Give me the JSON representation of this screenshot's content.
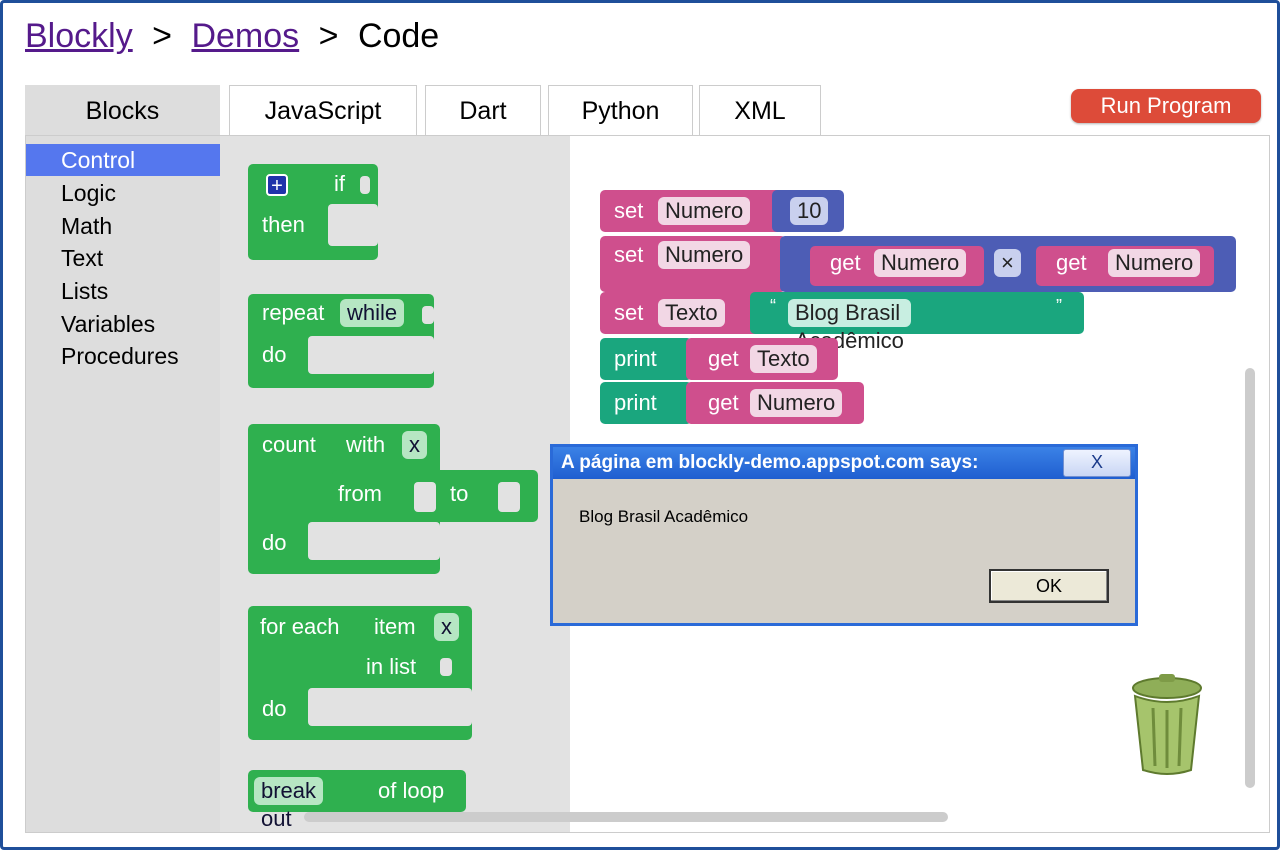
{
  "breadcrumb": {
    "link1": "Blockly",
    "sep1": ">",
    "link2": "Demos",
    "sep2": ">",
    "current": "Code"
  },
  "tabs": [
    {
      "label": "Blocks",
      "active": true
    },
    {
      "label": "JavaScript"
    },
    {
      "label": "Dart"
    },
    {
      "label": "Python"
    },
    {
      "label": "XML"
    }
  ],
  "run_button": "Run Program",
  "toolbox": [
    "Control",
    "Logic",
    "Math",
    "Text",
    "Lists",
    "Variables",
    "Procedures"
  ],
  "flyout": {
    "if_block": {
      "if": "if",
      "then": "then"
    },
    "repeat_block": {
      "repeat": "repeat",
      "mode": "while",
      "do": "do"
    },
    "count_block": {
      "count": "count",
      "with": "with",
      "var": "x",
      "from": "from",
      "to": "to",
      "do": "do"
    },
    "foreach_block": {
      "for_each": "for each",
      "item": "item",
      "var": "x",
      "in_list": "in list",
      "do": "do"
    },
    "break_block": {
      "break_out": "break out",
      "of_loop": "of loop"
    }
  },
  "program": {
    "set1": {
      "set": "set",
      "var": "Numero",
      "value": "10"
    },
    "set2": {
      "set": "set",
      "var": "Numero",
      "get1": "get",
      "var1": "Numero",
      "op": "×",
      "get2": "get",
      "var2": "Numero"
    },
    "set3": {
      "set": "set",
      "var": "Texto",
      "quote_open": "“",
      "text": "Blog Brasil Acadêmico",
      "quote_close": "”"
    },
    "print1": {
      "print": "print",
      "get": "get",
      "var": "Texto"
    },
    "print2": {
      "print": "print",
      "get": "get",
      "var": "Numero"
    }
  },
  "dialog": {
    "title": "A página em blockly-demo.appspot.com says:",
    "close": "X",
    "message": "Blog Brasil Acadêmico",
    "ok": "OK"
  },
  "colors": {
    "accent_run": "#dd4b39",
    "control_green": "#2fb04f",
    "variables_pink": "#cf4f8d",
    "math_blue": "#4d5db5",
    "text_teal": "#1aa67e",
    "dialog_blue": "#2a6ad8"
  }
}
